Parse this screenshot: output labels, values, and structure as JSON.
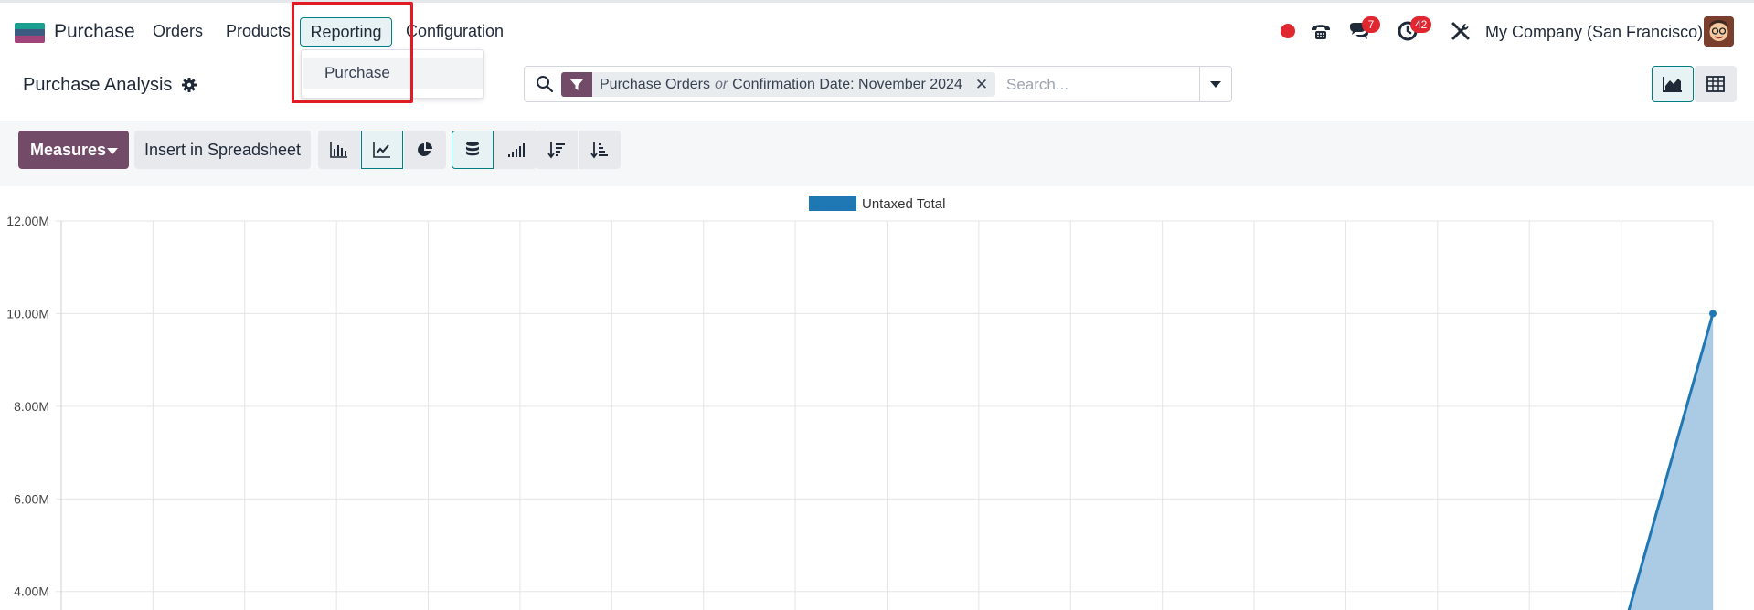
{
  "navbar": {
    "app_name": "Purchase",
    "menu": [
      "Orders",
      "Products",
      "Reporting",
      "Configuration"
    ],
    "active_menu": "Reporting",
    "dropdown_items": [
      "Purchase"
    ],
    "messages_badge": "7",
    "activities_badge": "42",
    "company": "My Company (San Francisco)"
  },
  "control_panel": {
    "title": "Purchase Analysis",
    "facet": {
      "part1": "Purchase Orders",
      "separator": "or",
      "part2": "Confirmation Date: November 2024"
    },
    "search_placeholder": "Search..."
  },
  "toolbar": {
    "measures_label": "Measures",
    "spreadsheet_label": "Insert in Spreadsheet"
  },
  "colors": {
    "brand": "#714b67",
    "accent": "#017e84",
    "series": "#1f77b4",
    "area_fill": "#a6c8e4",
    "badge": "#e0262f"
  },
  "chart_data": {
    "type": "area",
    "series": [
      {
        "name": "Untaxed Total",
        "values": [
          null,
          null,
          null,
          null,
          null,
          null,
          null,
          null,
          null,
          null,
          null,
          null,
          null,
          null,
          null,
          null,
          null,
          3000000,
          10000000
        ]
      }
    ],
    "y_tick_labels": [
      "12.00M",
      "10.00M",
      "8.00M",
      "6.00M",
      "4.00M"
    ],
    "y_ticks": [
      12000000,
      10000000,
      8000000,
      6000000,
      4000000
    ],
    "ylim_visible": [
      3600000,
      12000000
    ],
    "grid": true,
    "legend": "top-center"
  }
}
